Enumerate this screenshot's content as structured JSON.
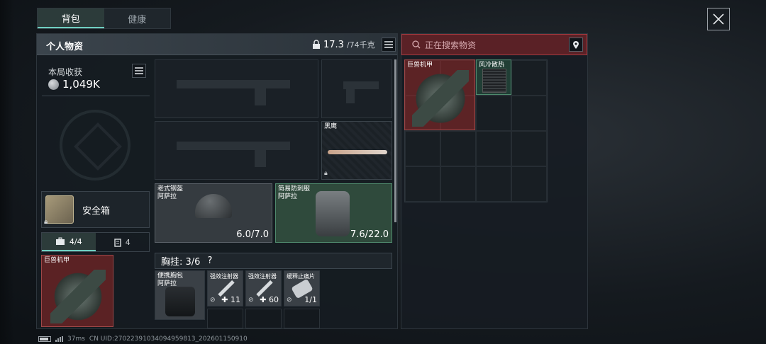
{
  "tabs": {
    "backpack": "背包",
    "health": "健康"
  },
  "personal": {
    "title": "个人物资",
    "weight_current": "17.3",
    "weight_max": "/74千克"
  },
  "harvest": {
    "label": "本局收获",
    "value": "1,049K"
  },
  "safebox": {
    "label": "安全箱"
  },
  "subtabs": {
    "a": "4/4",
    "b": "4"
  },
  "items": {
    "mech_left": "巨兽机甲",
    "knife": "黑鹰",
    "helmet_name": "老式钢盔",
    "helmet_sub": "阿萨拉",
    "helmet_durability": "6.0/7.0",
    "armor_name": "简易防刺服",
    "armor_sub": "阿萨拉",
    "armor_durability": "7.6/22.0",
    "chest_rig_label": "胸挂: 3/6",
    "chest_rig_help": "?",
    "bag_name": "便携胸包",
    "bag_sub": "阿萨拉",
    "inj1_name": "强效注射器",
    "inj1_count": "11",
    "inj2_name": "强效注射器",
    "inj2_count": "60",
    "pills_name": "缓释止痛片",
    "pills_count": "1/1"
  },
  "search": {
    "placeholder": "正在搜索物资"
  },
  "loot": {
    "mech": "巨兽机甲",
    "cooler": "风冷散热"
  },
  "status": {
    "ping": "37ms",
    "uid": "CN UID:2702239103409495​9813_202601150910"
  }
}
